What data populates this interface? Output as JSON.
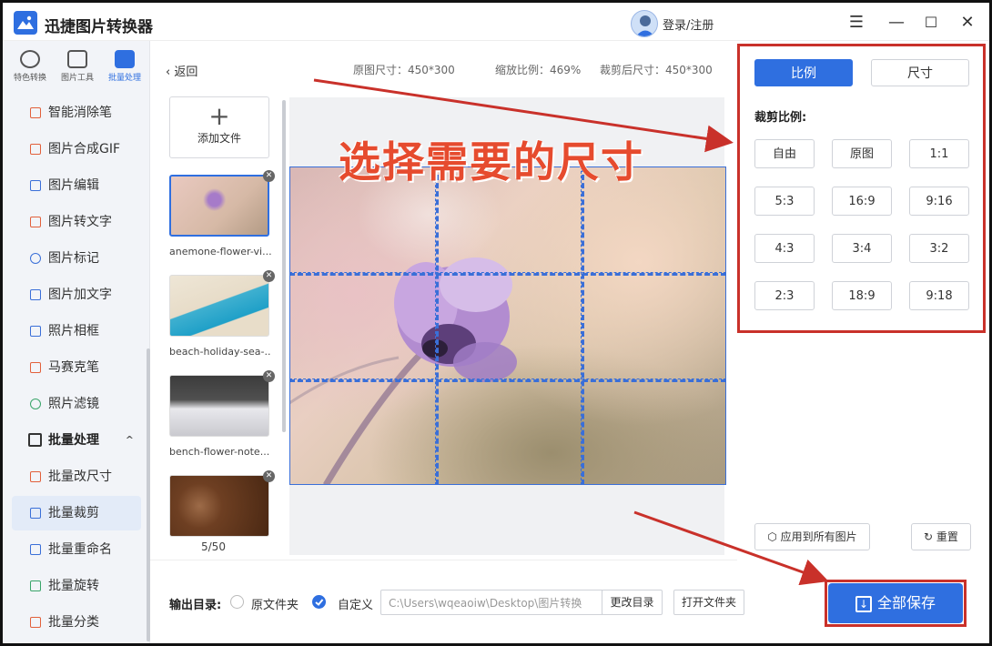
{
  "app": {
    "title": "迅捷图片转换器",
    "login_label": "登录/注册"
  },
  "window_controls": {
    "menu": "☰",
    "minimize": "—",
    "maximize": "☐",
    "close": "✕"
  },
  "sidebar": {
    "tabs": [
      {
        "label": "特色转换",
        "icon": "convert-icon"
      },
      {
        "label": "图片工具",
        "icon": "toolbox-icon"
      },
      {
        "label": "批量处理",
        "icon": "batch-icon",
        "active": true
      }
    ],
    "items": [
      {
        "label": "智能消除笔",
        "icon": "eraser-pen-icon"
      },
      {
        "label": "图片合成GIF",
        "icon": "gif-icon"
      },
      {
        "label": "图片编辑",
        "icon": "edit-icon"
      },
      {
        "label": "图片转文字",
        "icon": "ocr-icon"
      },
      {
        "label": "图片标记",
        "icon": "mark-icon"
      },
      {
        "label": "图片加文字",
        "icon": "add-text-icon"
      },
      {
        "label": "照片相框",
        "icon": "frame-icon"
      },
      {
        "label": "马赛克笔",
        "icon": "mosaic-icon"
      },
      {
        "label": "照片滤镜",
        "icon": "filter-icon"
      }
    ],
    "group": {
      "label": "批量处理",
      "chevron": "^"
    },
    "group_items": [
      {
        "label": "批量改尺寸",
        "icon": "resize-icon"
      },
      {
        "label": "批量裁剪",
        "icon": "crop-icon",
        "active": true
      },
      {
        "label": "批量重命名",
        "icon": "rename-icon"
      },
      {
        "label": "批量旋转",
        "icon": "rotate-icon"
      },
      {
        "label": "批量分类",
        "icon": "classify-icon"
      }
    ]
  },
  "header": {
    "back_label": "返回",
    "original_size": "原图尺寸：450*300",
    "zoom": "缩放比例：469%",
    "cropped_size": "裁剪后尺寸：450*300"
  },
  "files": {
    "add_label": "添加文件",
    "items": [
      {
        "name": "anemone-flower-vi...",
        "selected": true
      },
      {
        "name": "beach-holiday-sea-..."
      },
      {
        "name": "bench-flower-note..."
      },
      {
        "name": ""
      }
    ],
    "count": "5/50"
  },
  "annotation": {
    "text": "选择需要的尺寸",
    "color": "#e64b2e"
  },
  "right_panel": {
    "tabs": [
      {
        "label": "比例",
        "active": true
      },
      {
        "label": "尺寸"
      }
    ],
    "ratio_title": "裁剪比例:",
    "ratios": [
      "自由",
      "原图",
      "1:1",
      "5:3",
      "16:9",
      "9:16",
      "4:3",
      "3:4",
      "3:2",
      "2:3",
      "18:9",
      "9:18"
    ],
    "apply_all_label": "应用到所有图片",
    "reset_label": "重置",
    "save_all_label": "全部保存"
  },
  "output": {
    "label": "输出目录:",
    "option_original": "原文件夹",
    "option_custom": "自定义",
    "selected": "custom",
    "path": "C:\\Users\\wqeaoiw\\Desktop\\图片转换",
    "change_dir_label": "更改目录",
    "open_folder_label": "打开文件夹"
  },
  "colors": {
    "accent": "#2f6fe0",
    "highlight_red": "#c9312a"
  }
}
